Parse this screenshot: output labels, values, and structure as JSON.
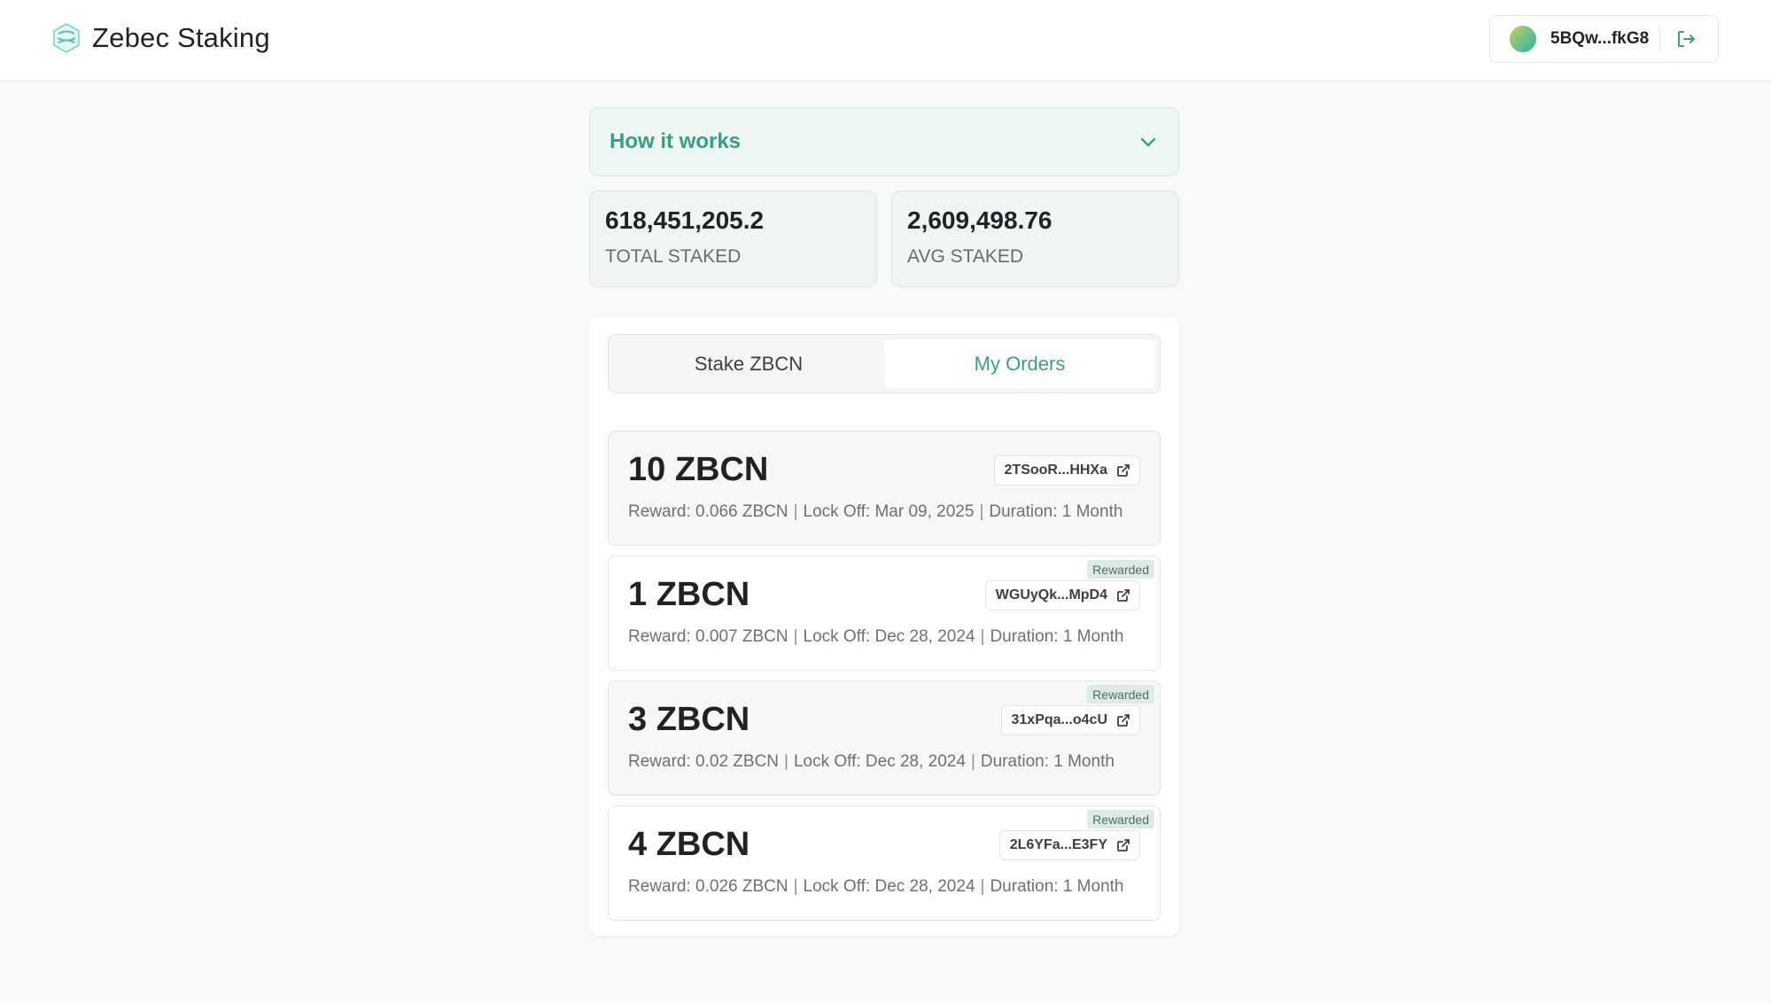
{
  "header": {
    "brand_name": "Zebec Staking",
    "wallet_address": "5BQw...fkG8"
  },
  "how_it_works": {
    "title": "How it works"
  },
  "stats": {
    "total": {
      "value": "618,451,205.2",
      "label": "TOTAL STAKED"
    },
    "avg": {
      "value": "2,609,498.76",
      "label": "AVG STAKED"
    }
  },
  "tabs": {
    "stake": "Stake ZBCN",
    "orders": "My Orders",
    "active": "orders"
  },
  "orders": [
    {
      "amount": "10 ZBCN",
      "tx": "2TSooR...HHXa",
      "reward": "Reward: 0.066 ZBCN",
      "lock_off": "Lock Off: Mar 09, 2025",
      "duration": "Duration: 1 Month",
      "badge": ""
    },
    {
      "amount": "1 ZBCN",
      "tx": "WGUyQk...MpD4",
      "reward": "Reward: 0.007 ZBCN",
      "lock_off": "Lock Off: Dec 28, 2024",
      "duration": "Duration: 1 Month",
      "badge": "Rewarded"
    },
    {
      "amount": "3 ZBCN",
      "tx": "31xPqa...o4cU",
      "reward": "Reward: 0.02 ZBCN",
      "lock_off": "Lock Off: Dec 28, 2024",
      "duration": "Duration: 1 Month",
      "badge": "Rewarded"
    },
    {
      "amount": "4 ZBCN",
      "tx": "2L6YFa...E3FY",
      "reward": "Reward: 0.026 ZBCN",
      "lock_off": "Lock Off: Dec 28, 2024",
      "duration": "Duration: 1 Month",
      "badge": "Rewarded"
    }
  ],
  "colors": {
    "accent": "#3a9d86",
    "accent_bg": "#eef6f4",
    "page_bg": "#f8f9f9",
    "badge_bg": "#dcebe6"
  },
  "icons": {
    "logo": "zebec-logo-icon",
    "logout": "logout-icon",
    "chevron": "chevron-down-icon",
    "external_link": "external-link-icon"
  }
}
